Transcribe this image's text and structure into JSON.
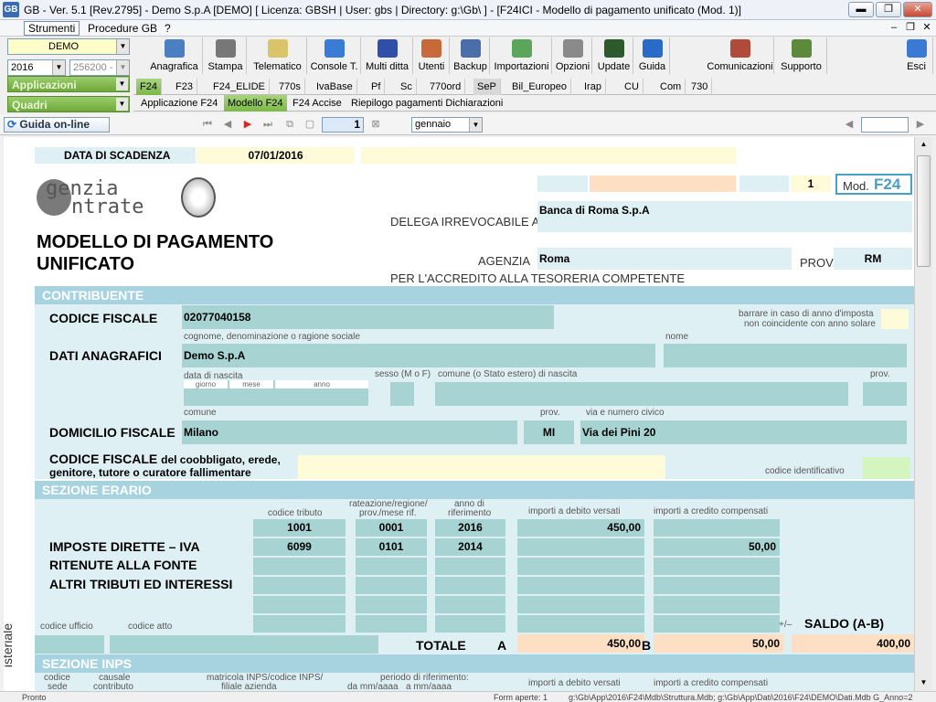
{
  "titlebar": {
    "title": "GB - Ver. 5.1 [Rev.2795] -  Demo S.p.A [DEMO]    [ Licenza: GBSH | User: gbs | Directory: g:\\Gb\\ ] - [F24ICI - Modello di pagamento unificato (Mod. 1)]",
    "app_icon": "GB",
    "min_label": "▬",
    "max_label": "❐",
    "close_label": "✕"
  },
  "menubar": {
    "items": [
      "Strumenti",
      "Procedure GB",
      "?"
    ],
    "mdi_min": "–",
    "mdi_restore": "❐",
    "mdi_close": "✕"
  },
  "leftpanel": {
    "company": "DEMO",
    "year": "2016",
    "code": "256200 -",
    "applicazioni": "Applicazioni",
    "quadri": "Quadri"
  },
  "toolbar": {
    "buttons": [
      {
        "label": "Anagrafica",
        "icon": "book-icon",
        "color": "#4a7fc1"
      },
      {
        "label": "Stampa",
        "icon": "printer-icon",
        "color": "#777777"
      },
      {
        "label": "Telematico",
        "icon": "notepad-icon",
        "color": "#d9c46a"
      },
      {
        "label": "Console T.",
        "icon": "console-icon",
        "color": "#3a7bd5"
      },
      {
        "label": "Multi ditta",
        "icon": "multiditta-icon",
        "color": "#2f4fa8"
      },
      {
        "label": "Utenti",
        "icon": "users-icon",
        "color": "#c8693a"
      },
      {
        "label": "Backup",
        "icon": "backup-icon",
        "color": "#4b6ea8"
      },
      {
        "label": "Importazioni",
        "icon": "import-icon",
        "color": "#5ca65c"
      },
      {
        "label": "Opzioni",
        "icon": "wrench-icon",
        "color": "#8a8a8a"
      },
      {
        "label": "Update",
        "icon": "monitor-icon",
        "color": "#2c5a2c"
      },
      {
        "label": "Guida",
        "icon": "help-icon",
        "color": "#2a6bc9"
      },
      {
        "label": "Comunicazioni",
        "icon": "communications-icon",
        "color": "#b04a3a"
      },
      {
        "label": "Supporto",
        "icon": "support-icon",
        "color": "#5a8a3a"
      },
      {
        "label": "Esci",
        "icon": "exit-icon",
        "color": "#3a7ad5"
      }
    ]
  },
  "tabs_main": [
    "F24",
    "F23",
    "F24_ELIDE",
    "770s",
    "IvaBase",
    "Pf",
    "Sc",
    "770ord",
    "SeP",
    "Bil_Europeo",
    "Irap",
    "CU",
    "Com",
    "730"
  ],
  "tabs_sub": [
    "Applicazione F24",
    "Modello F24",
    "F24 Accise",
    "Riepilogo pagamenti Dichiarazioni"
  ],
  "navrow": {
    "guida": "Guida on-line",
    "page": "1",
    "month": "gennaio"
  },
  "form": {
    "data_scadenza_label": "DATA DI SCADENZA",
    "data_scadenza": "07/01/2016",
    "agenzia_logo_top": "genzia",
    "agenzia_logo_bottom": "ntrate",
    "page_num": "1",
    "mod_label": "Mod.",
    "mod_f24": "F24",
    "delega_label": "DELEGA IRREVOCABILE A:",
    "banca": "Banca di Roma S.p.A",
    "title_line1": "MODELLO DI PAGAMENTO",
    "title_line2": "UNIFICATO",
    "agenzia_label": "AGENZIA",
    "agenzia": "Roma",
    "prov_label": "PROV.",
    "prov": "RM",
    "accredito": "PER L'ACCREDITO ALLA TESORERIA COMPETENTE",
    "contribuente": "CONTRIBUENTE",
    "codice_fiscale_label": "CODICE FISCALE",
    "codice_fiscale": "02077040158",
    "barrare_line1": "barrare in caso di anno d'imposta",
    "barrare_line2": "non coincidente con anno solare",
    "cognome_label": "cognome, denominazione o ragione sociale",
    "nome_label": "nome",
    "dati_anagrafici_label": "DATI ANAGRAFICI",
    "denominazione": "Demo S.p.A",
    "data_nascita_label": "data di nascita",
    "giorno_label": "giorno",
    "mese_label": "mese",
    "anno_label": "anno",
    "sesso_label": "sesso (M o F)",
    "comune_nascita_label": "comune (o Stato estero) di nascita",
    "prov_small_label": "prov.",
    "comune_label": "comune",
    "prov2_label": "prov.",
    "via_label": "via e numero civico",
    "domicilio_label": "DOMICILIO FISCALE",
    "domicilio_comune": "Milano",
    "domicilio_prov": "MI",
    "domicilio_via": "Via dei Pini 20",
    "coobbligato_bold": "CODICE FISCALE",
    "coobbligato_line1": "del coobbligato, erede,",
    "coobbligato_line2": "genitore, tutore o curatore fallimentare",
    "codice_identificativo_label": "codice identificativo",
    "sezione_erario": "SEZIONE ERARIO",
    "col_codice_tributo": "codice tributo",
    "col_rateazione_1": "rateazione/regione/",
    "col_rateazione_2": "prov./mese rif.",
    "col_anno_1": "anno di",
    "col_anno_2": "riferimento",
    "col_debito": "importi a debito versati",
    "col_credito": "importi a credito compensati",
    "imposte_label": "IMPOSTE DIRETTE – IVA",
    "ritenute_label": "RITENUTE ALLA FONTE",
    "altri_label": "ALTRI TRIBUTI ED INTERESSI",
    "rows": [
      {
        "tributo": "1001",
        "rateazione": "0001",
        "anno": "2016",
        "debito": "450,00",
        "credito": ""
      },
      {
        "tributo": "6099",
        "rateazione": "0101",
        "anno": "2014",
        "debito": "",
        "credito": "50,00"
      },
      {
        "tributo": "",
        "rateazione": "",
        "anno": "",
        "debito": "",
        "credito": ""
      },
      {
        "tributo": "",
        "rateazione": "",
        "anno": "",
        "debito": "",
        "credito": ""
      },
      {
        "tributo": "",
        "rateazione": "",
        "anno": "",
        "debito": "",
        "credito": ""
      },
      {
        "tributo": "",
        "rateazione": "",
        "anno": "",
        "debito": "",
        "credito": ""
      }
    ],
    "codice_ufficio_label": "codice ufficio",
    "codice_atto_label": "codice atto",
    "plusminus": "+/–",
    "saldo_label": "SALDO  (A-B)",
    "totale_label": "TOTALE",
    "a_label": "A",
    "b_label": "B",
    "totale_debito": "450,00",
    "totale_credito": "50,00",
    "saldo": "400,00",
    "vertical_label": "isteriale",
    "sezione_inps": "SEZIONE INPS",
    "inps_col1a": "codice",
    "inps_col1b": "sede",
    "inps_col2a": "causale",
    "inps_col2b": "contributo",
    "inps_col3a": "matricola INPS/codice INPS/",
    "inps_col3b": "filiale azienda",
    "inps_col4a": "periodo di riferimento:",
    "inps_col4b": "da mm/aaaa",
    "inps_col4c": "a mm/aaaa",
    "inps_col5": "importi a debito versati",
    "inps_col6": "importi a credito compensati"
  },
  "statusbar": {
    "left": "Pronto",
    "middle": "Form aperte: 1",
    "right": "g:\\Gb\\App\\2016\\F24\\Mdb\\Struttura.Mdb; g:\\Gb\\App\\Dati\\2016\\F24\\DEMO\\Dati.Mdb G_Anno=2"
  }
}
